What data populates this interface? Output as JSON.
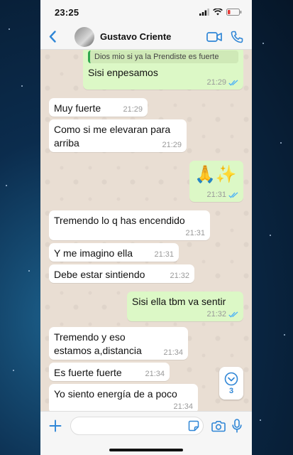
{
  "status_bar": {
    "time": "23:25"
  },
  "header": {
    "contact_name": "Gustavo Criente"
  },
  "messages": [
    {
      "dir": "out",
      "quote": "Dios mio si ya la Prendiste es fuerte",
      "text": "Sisi enpesamos",
      "time": "21:29",
      "read": true
    },
    {
      "dir": "in",
      "text": "Muy fuerte",
      "time": "21:29"
    },
    {
      "dir": "in",
      "text": "Como si me elevaran para arriba",
      "time": "21:29"
    },
    {
      "dir": "out",
      "text": "🙏✨",
      "time": "21:31",
      "read": true
    },
    {
      "dir": "in",
      "text": "Tremendo lo q has encendido",
      "time": "21:31"
    },
    {
      "dir": "in",
      "text": "Y me imagino ella",
      "time": "21:31"
    },
    {
      "dir": "in",
      "text": "Debe estar sintiendo",
      "time": "21:32"
    },
    {
      "dir": "out",
      "text": "Sisi ella tbm va sentir",
      "time": "21:32",
      "read": true
    },
    {
      "dir": "in",
      "text": "Tremendo y eso estamos a,distancia",
      "time": "21:34"
    },
    {
      "dir": "in",
      "text": "Es fuerte fuerte",
      "time": "21:34"
    },
    {
      "dir": "in",
      "text": "Yo siento energía de a poco",
      "time": "21:34"
    }
  ],
  "scroll_down": {
    "unread_count": "3"
  },
  "composer": {
    "placeholder": ""
  },
  "colors": {
    "accent": "#2f86d6",
    "outgoing_bubble": "#dcf8c6",
    "read_ticks": "#4fb3f6"
  }
}
